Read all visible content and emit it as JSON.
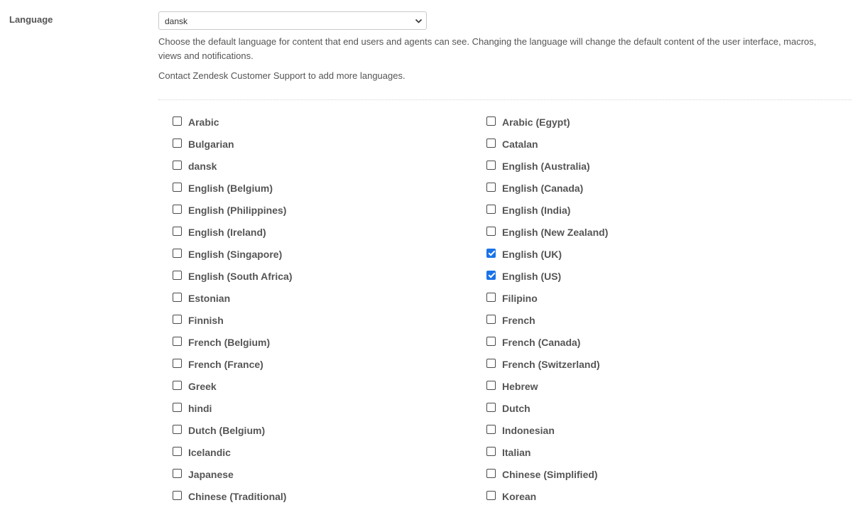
{
  "section": {
    "label": "Language"
  },
  "language_select": {
    "selected": "dansk",
    "icon": "chevron-down-icon"
  },
  "hints": {
    "description": "Choose the default language for content that end users and agents can see. Changing the language will change the default content of the user interface, macros, views and notifications.",
    "contact": "Contact Zendesk Customer Support to add more languages."
  },
  "colors": {
    "checked": "#1a73e8",
    "text": "#555555",
    "border": "#c9c9c9"
  },
  "languages": [
    {
      "label": "Arabic",
      "checked": false
    },
    {
      "label": "Arabic (Egypt)",
      "checked": false
    },
    {
      "label": "Bulgarian",
      "checked": false
    },
    {
      "label": "Catalan",
      "checked": false
    },
    {
      "label": "dansk",
      "checked": false
    },
    {
      "label": "English (Australia)",
      "checked": false
    },
    {
      "label": "English (Belgium)",
      "checked": false
    },
    {
      "label": "English (Canada)",
      "checked": false
    },
    {
      "label": "English (Philippines)",
      "checked": false
    },
    {
      "label": "English (India)",
      "checked": false
    },
    {
      "label": "English (Ireland)",
      "checked": false
    },
    {
      "label": "English (New Zealand)",
      "checked": false
    },
    {
      "label": "English (Singapore)",
      "checked": false
    },
    {
      "label": "English (UK)",
      "checked": true
    },
    {
      "label": "English (South Africa)",
      "checked": false
    },
    {
      "label": "English (US)",
      "checked": true
    },
    {
      "label": "Estonian",
      "checked": false
    },
    {
      "label": "Filipino",
      "checked": false
    },
    {
      "label": "Finnish",
      "checked": false
    },
    {
      "label": "French",
      "checked": false
    },
    {
      "label": "French (Belgium)",
      "checked": false
    },
    {
      "label": "French (Canada)",
      "checked": false
    },
    {
      "label": "French (France)",
      "checked": false
    },
    {
      "label": "French (Switzerland)",
      "checked": false
    },
    {
      "label": "Greek",
      "checked": false
    },
    {
      "label": "Hebrew",
      "checked": false
    },
    {
      "label": "hindi",
      "checked": false
    },
    {
      "label": "Dutch",
      "checked": false
    },
    {
      "label": "Dutch (Belgium)",
      "checked": false
    },
    {
      "label": "Indonesian",
      "checked": false
    },
    {
      "label": "Icelandic",
      "checked": false
    },
    {
      "label": "Italian",
      "checked": false
    },
    {
      "label": "Japanese",
      "checked": false
    },
    {
      "label": "Chinese (Simplified)",
      "checked": false
    },
    {
      "label": "Chinese (Traditional)",
      "checked": false
    },
    {
      "label": "Korean",
      "checked": false
    }
  ]
}
